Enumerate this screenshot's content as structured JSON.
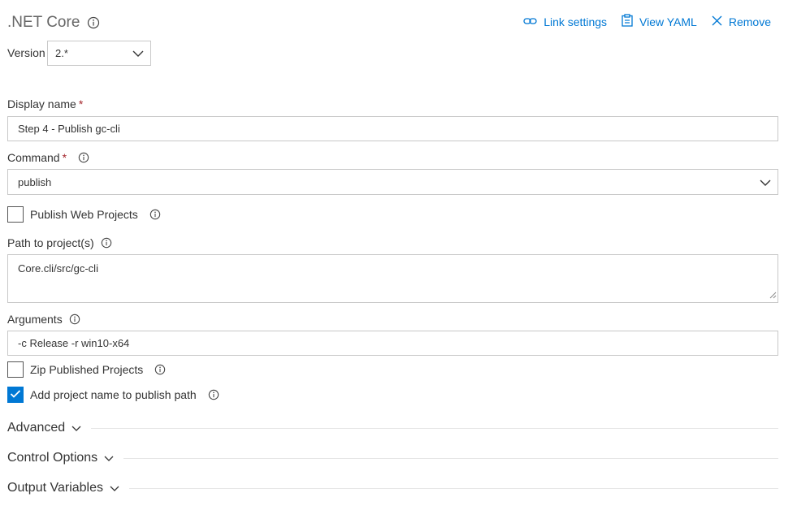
{
  "task": {
    "title": ".NET Core"
  },
  "actions": {
    "link_settings": "Link settings",
    "view_yaml": "View YAML",
    "remove": "Remove"
  },
  "version": {
    "label": "Version",
    "value": "2.*"
  },
  "display_name": {
    "label": "Display name",
    "required_mark": "*",
    "value": "Step 4 - Publish gc-cli"
  },
  "command": {
    "label": "Command",
    "required_mark": "*",
    "value": "publish"
  },
  "publish_web_projects": {
    "label": "Publish Web Projects",
    "checked": false
  },
  "path_to_projects": {
    "label": "Path to project(s)",
    "value": "Core.cli/src/gc-cli"
  },
  "arguments": {
    "label": "Arguments",
    "value": "-c Release -r win10-x64"
  },
  "zip_published_projects": {
    "label": "Zip Published Projects",
    "checked": false
  },
  "add_project_name": {
    "label": "Add project name to publish path",
    "checked": true
  },
  "sections": {
    "advanced": "Advanced",
    "control_options": "Control Options",
    "output_variables": "Output Variables"
  },
  "colors": {
    "accent": "#0078d4",
    "required": "#a4262c",
    "border": "#c8c8c8"
  }
}
